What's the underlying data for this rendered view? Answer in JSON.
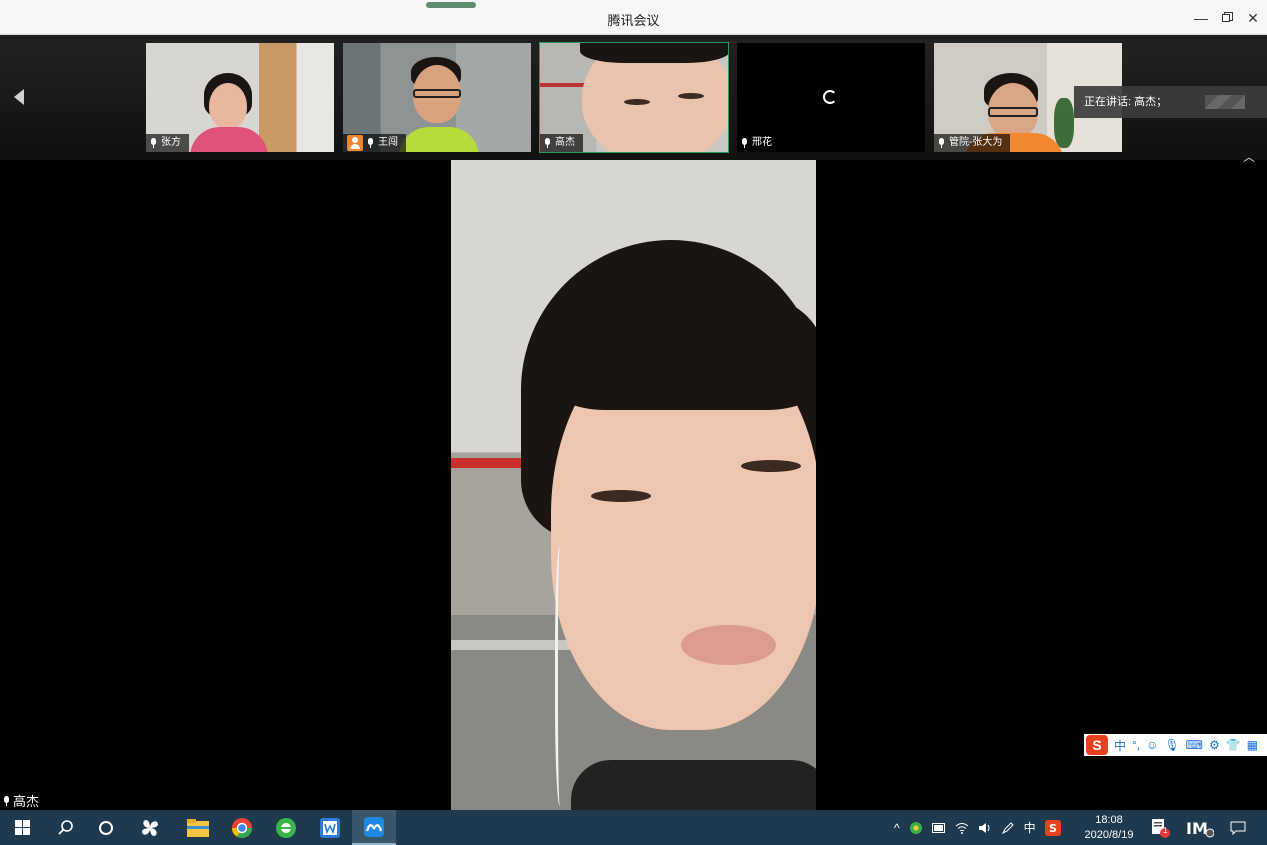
{
  "window": {
    "title": "腾讯会议"
  },
  "thumbnails": [
    {
      "name": "张方",
      "active": false
    },
    {
      "name": "王闯",
      "active": false
    },
    {
      "name": "高杰",
      "active": true
    },
    {
      "name": "邢花",
      "active": false
    },
    {
      "name": "管院-张大为",
      "active": false
    }
  ],
  "speaking_banner": "正在讲话: 高杰；",
  "main_speaker": "高杰",
  "ime": {
    "mode": "中",
    "punct": "°,"
  },
  "tray": {
    "lang": "中"
  },
  "clock": {
    "time": "18:08",
    "date": "2020/8/19"
  },
  "notification_count": "1",
  "icons": {
    "start": "windows-logo-icon",
    "search": "search-icon",
    "cortana": "circle-icon",
    "pinwheel": "pinwheel-icon",
    "explorer": "folder-icon",
    "chrome": "browser-icon",
    "ie": "edge-icon",
    "wps": "wps-icon",
    "meeting": "tencent-meeting-icon"
  },
  "colors": {
    "active_border": "#2d9a5d",
    "taskbar": "#1f3a4e",
    "ime_logo": "#e8411f"
  }
}
